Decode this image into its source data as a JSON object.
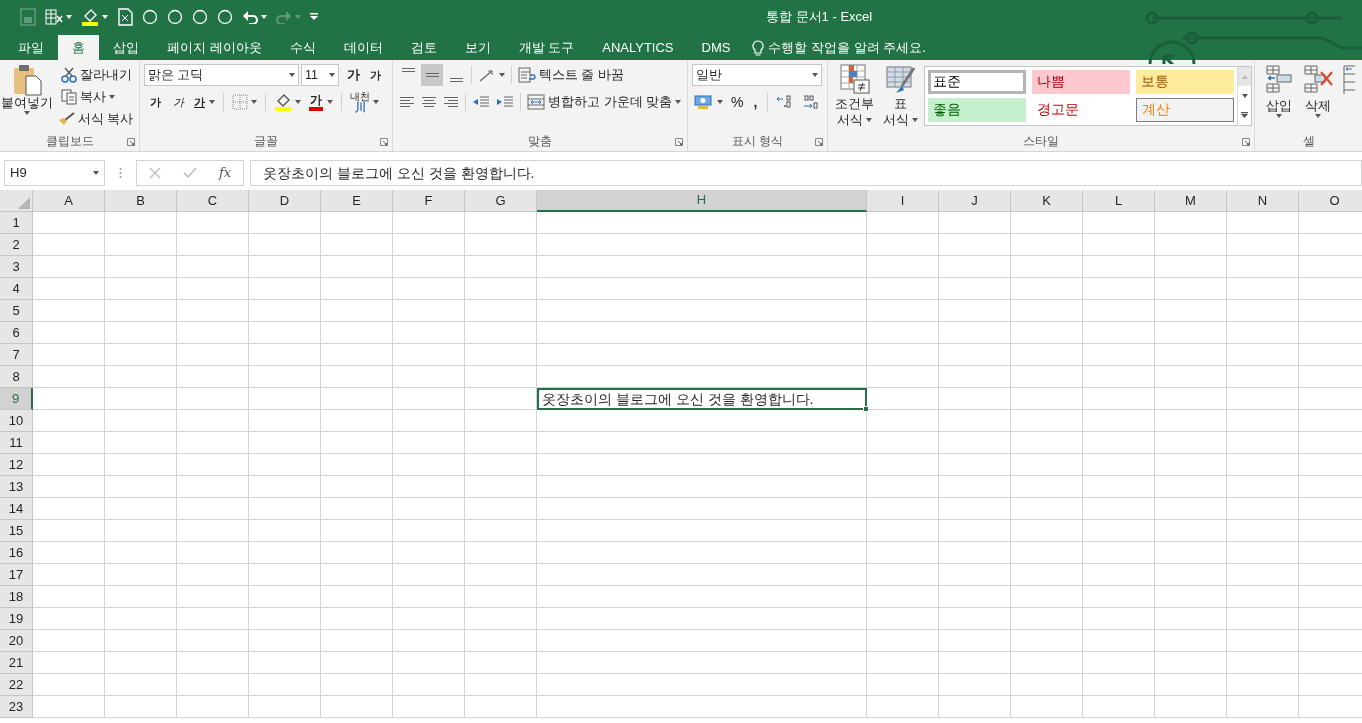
{
  "window": {
    "title": "통합 문서1 - Excel"
  },
  "tabs": [
    {
      "label": "파일",
      "selected": false
    },
    {
      "label": "홈",
      "selected": true
    },
    {
      "label": "삽입",
      "selected": false
    },
    {
      "label": "페이지 레이아웃",
      "selected": false
    },
    {
      "label": "수식",
      "selected": false
    },
    {
      "label": "데이터",
      "selected": false
    },
    {
      "label": "검토",
      "selected": false
    },
    {
      "label": "보기",
      "selected": false
    },
    {
      "label": "개발 도구",
      "selected": false
    },
    {
      "label": "ANALYTICS",
      "selected": false
    },
    {
      "label": "DMS",
      "selected": false
    }
  ],
  "tell_me": {
    "placeholder": "수행할 작업을 알려 주세요."
  },
  "clipboard": {
    "label": "클립보드",
    "paste": "붙여넣기",
    "cut": "잘라내기",
    "copy": "복사",
    "format_painter": "서식 복사"
  },
  "font": {
    "label": "글꼴",
    "font_name": "맑은 고딕",
    "font_size": "11",
    "grow": "가",
    "shrink": "가",
    "bold": "가",
    "italic": "가",
    "underline": "가",
    "font_color": "가",
    "phonetic_top": "내천",
    "phonetic_bottom": "川"
  },
  "alignment": {
    "label": "맞춤",
    "wrap_text": "텍스트 줄 바꿈",
    "merge_center": "병합하고 가운데 맞춤"
  },
  "number": {
    "label": "표시 형식",
    "format": "일반",
    "percent": "%",
    "comma": ","
  },
  "styles": {
    "label": "스타일",
    "conditional_top": "조건부",
    "conditional_bottom": "서식",
    "table_top": "표",
    "table_bottom": "서식",
    "gallery": [
      {
        "label": "표준",
        "kind": "normal",
        "selected": true
      },
      {
        "label": "나쁨",
        "kind": "bad",
        "selected": false
      },
      {
        "label": "보통",
        "kind": "neutral",
        "selected": false
      },
      {
        "label": "좋음",
        "kind": "good",
        "selected": false
      },
      {
        "label": "경고문",
        "kind": "warning",
        "selected": false
      },
      {
        "label": "계산",
        "kind": "calculation",
        "selected": false
      }
    ]
  },
  "cells_group": {
    "label": "셀",
    "insert": "삽입",
    "delete": "삭제"
  },
  "formula_bar": {
    "name_box": "H9",
    "function_label": "fx",
    "formula": "옷장초이의 블로그에 오신 것을 환영합니다."
  },
  "sheet": {
    "columns": [
      {
        "label": "A",
        "selected": false
      },
      {
        "label": "B",
        "selected": false
      },
      {
        "label": "C",
        "selected": false
      },
      {
        "label": "D",
        "selected": false
      },
      {
        "label": "E",
        "selected": false
      },
      {
        "label": "F",
        "selected": false
      },
      {
        "label": "G",
        "selected": false
      },
      {
        "label": "H",
        "selected": true
      },
      {
        "label": "I",
        "selected": false
      },
      {
        "label": "J",
        "selected": false
      },
      {
        "label": "K",
        "selected": false
      },
      {
        "label": "L",
        "selected": false
      },
      {
        "label": "M",
        "selected": false
      },
      {
        "label": "N",
        "selected": false
      },
      {
        "label": "O",
        "selected": false
      }
    ],
    "rows": [
      {
        "label": "1",
        "selected": false
      },
      {
        "label": "2",
        "selected": false
      },
      {
        "label": "3",
        "selected": false
      },
      {
        "label": "4",
        "selected": false
      },
      {
        "label": "5",
        "selected": false
      },
      {
        "label": "6",
        "selected": false
      },
      {
        "label": "7",
        "selected": false
      },
      {
        "label": "8",
        "selected": false
      },
      {
        "label": "9",
        "selected": true,
        "cells": [
          {
            "value": "옷장초이의 블로그에 오신 것을 환영합니다.",
            "selected": true
          }
        ]
      },
      {
        "label": "10",
        "selected": false
      },
      {
        "label": "11",
        "selected": false
      },
      {
        "label": "12",
        "selected": false
      },
      {
        "label": "13",
        "selected": false
      },
      {
        "label": "14",
        "selected": false
      },
      {
        "label": "15",
        "selected": false
      },
      {
        "label": "16",
        "selected": false
      },
      {
        "label": "17",
        "selected": false
      },
      {
        "label": "18",
        "selected": false
      },
      {
        "label": "19",
        "selected": false
      },
      {
        "label": "20",
        "selected": false
      },
      {
        "label": "21",
        "selected": false
      },
      {
        "label": "22",
        "selected": false
      },
      {
        "label": "23",
        "selected": false
      }
    ]
  }
}
